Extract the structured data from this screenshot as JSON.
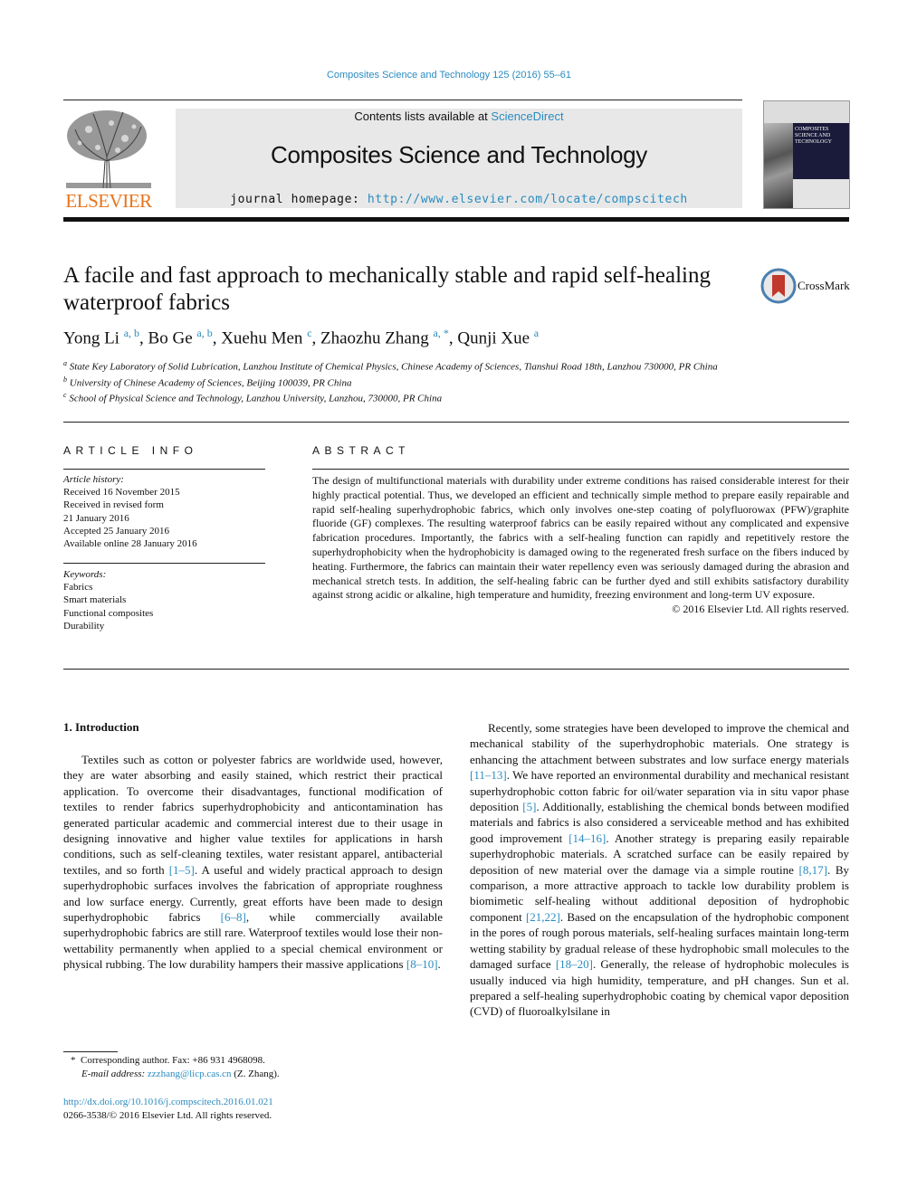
{
  "header": {
    "journal_ref": "Composites Science and Technology 125 (2016) 55–61",
    "contents_prefix": "Contents lists available at ",
    "contents_link": "ScienceDirect",
    "journal_title": "Composites Science and Technology",
    "homepage_prefix": "journal homepage: ",
    "homepage_link": "http://www.elsevier.com/locate/compscitech",
    "publisher_logo_text": "ELSEVIER",
    "cover_title": "COMPOSITES SCIENCE AND TECHNOLOGY"
  },
  "article": {
    "title": "A facile and fast approach to mechanically stable and rapid self-healing waterproof fabrics",
    "crossmark_label": "CrossMark",
    "authors": [
      {
        "name": "Yong Li",
        "sup": "a, b"
      },
      {
        "name": "Bo Ge",
        "sup": "a, b"
      },
      {
        "name": "Xuehu Men",
        "sup": "c"
      },
      {
        "name": "Zhaozhu Zhang",
        "sup": "a, *"
      },
      {
        "name": "Qunji Xue",
        "sup": "a"
      }
    ],
    "affiliations": [
      {
        "mark": "a",
        "text": "State Key Laboratory of Solid Lubrication, Lanzhou Institute of Chemical Physics, Chinese Academy of Sciences, Tianshui Road 18th, Lanzhou 730000, PR China"
      },
      {
        "mark": "b",
        "text": "University of Chinese Academy of Sciences, Beijing 100039, PR China"
      },
      {
        "mark": "c",
        "text": "School of Physical Science and Technology, Lanzhou University, Lanzhou, 730000, PR China"
      }
    ]
  },
  "article_info": {
    "heading": "ARTICLE INFO",
    "history_label": "Article history:",
    "history": [
      "Received 16 November 2015",
      "Received in revised form",
      "21 January 2016",
      "Accepted 25 January 2016",
      "Available online 28 January 2016"
    ],
    "keywords_label": "Keywords:",
    "keywords": [
      "Fabrics",
      "Smart materials",
      "Functional composites",
      "Durability"
    ]
  },
  "abstract": {
    "heading": "ABSTRACT",
    "text": "The design of multifunctional materials with durability under extreme conditions has raised considerable interest for their highly practical potential. Thus, we developed an efficient and technically simple method to prepare easily repairable and rapid self-healing superhydrophobic fabrics, which only involves one-step coating of polyfluorowax (PFW)/graphite fluoride (GF) complexes. The resulting waterproof fabrics can be easily repaired without any complicated and expensive fabrication procedures. Importantly, the fabrics with a self-healing function can rapidly and repetitively restore the superhydrophobicity when the hydrophobicity is damaged owing to the regenerated fresh surface on the fibers induced by heating. Furthermore, the fabrics can maintain their water repellency even was seriously damaged during the abrasion and mechanical stretch tests. In addition, the self-healing fabric can be further dyed and still exhibits satisfactory durability against strong acidic or alkaline, high temperature and humidity, freezing environment and long-term UV exposure.",
    "copyright": "© 2016 Elsevier Ltd. All rights reserved."
  },
  "body": {
    "section_heading": "1.  Introduction",
    "left_column": [
      {
        "t": "Textiles such as cotton or polyester fabrics are worldwide used, however, they are water absorbing and easily stained, which restrict their practical application. To overcome their disadvantages, functional modification of textiles to render fabrics superhydrophobicity and anticontamination has generated particular academic and commercial interest due to their usage in designing innovative and higher value textiles for applications in harsh conditions, such as self-cleaning textiles, water resistant apparel, antibacterial textiles, and so forth "
      },
      {
        "c": "[1–5]"
      },
      {
        "t": ". A useful and widely practical approach to design superhydrophobic surfaces involves the fabrication of appropriate roughness and low surface energy. Currently, great efforts have been made to design superhydrophobic fabrics "
      },
      {
        "c": "[6–8]"
      },
      {
        "t": ", while commercially available superhydrophobic fabrics are still rare. Waterproof textiles would lose their non-wettability permanently when applied to a special chemical environment or physical rubbing. The low durability hampers their massive applications "
      },
      {
        "c": "[8–10]"
      },
      {
        "t": "."
      }
    ],
    "right_column": [
      {
        "t": "Recently, some strategies have been developed to improve the chemical and mechanical stability of the superhydrophobic materials. One strategy is enhancing the attachment between substrates and low surface energy materials "
      },
      {
        "c": "[11–13]"
      },
      {
        "t": ". We have reported an environmental durability and mechanical resistant superhydrophobic cotton fabric for oil/water separation via in situ vapor phase deposition "
      },
      {
        "c": "[5]"
      },
      {
        "t": ". Additionally, establishing the chemical bonds between modified materials and fabrics is also considered a serviceable method and has exhibited good improvement "
      },
      {
        "c": "[14–16]"
      },
      {
        "t": ". Another strategy is preparing easily repairable superhydrophobic materials. A scratched surface can be easily repaired by deposition of new material over the damage via a simple routine "
      },
      {
        "c": "[8,17]"
      },
      {
        "t": ". By comparison, a more attractive approach to tackle low durability problem is biomimetic self-healing without additional deposition of hydrophobic component "
      },
      {
        "c": "[21,22]"
      },
      {
        "t": ". Based on the encapsulation of the hydrophobic component in the pores of rough porous materials, self-healing surfaces maintain long-term wetting stability by gradual release of these hydrophobic small molecules to the damaged surface "
      },
      {
        "c": "[18–20]"
      },
      {
        "t": ". Generally, the release of hydrophobic molecules is usually induced via high humidity, temperature, and pH changes. Sun et al. prepared a self-healing superhydrophobic coating by chemical vapor deposition (CVD) of fluoroalkylsilane in"
      }
    ]
  },
  "footnote": {
    "star": "*",
    "corresponding": "Corresponding author. Fax: +86 931 4968098.",
    "email_label": "E-mail address: ",
    "email": "zzzhang@licp.cas.cn",
    "email_suffix": " (Z. Zhang).",
    "doi": "http://dx.doi.org/10.1016/j.compscitech.2016.01.021",
    "issn_line": "0266-3538/© 2016 Elsevier Ltd. All rights reserved."
  }
}
